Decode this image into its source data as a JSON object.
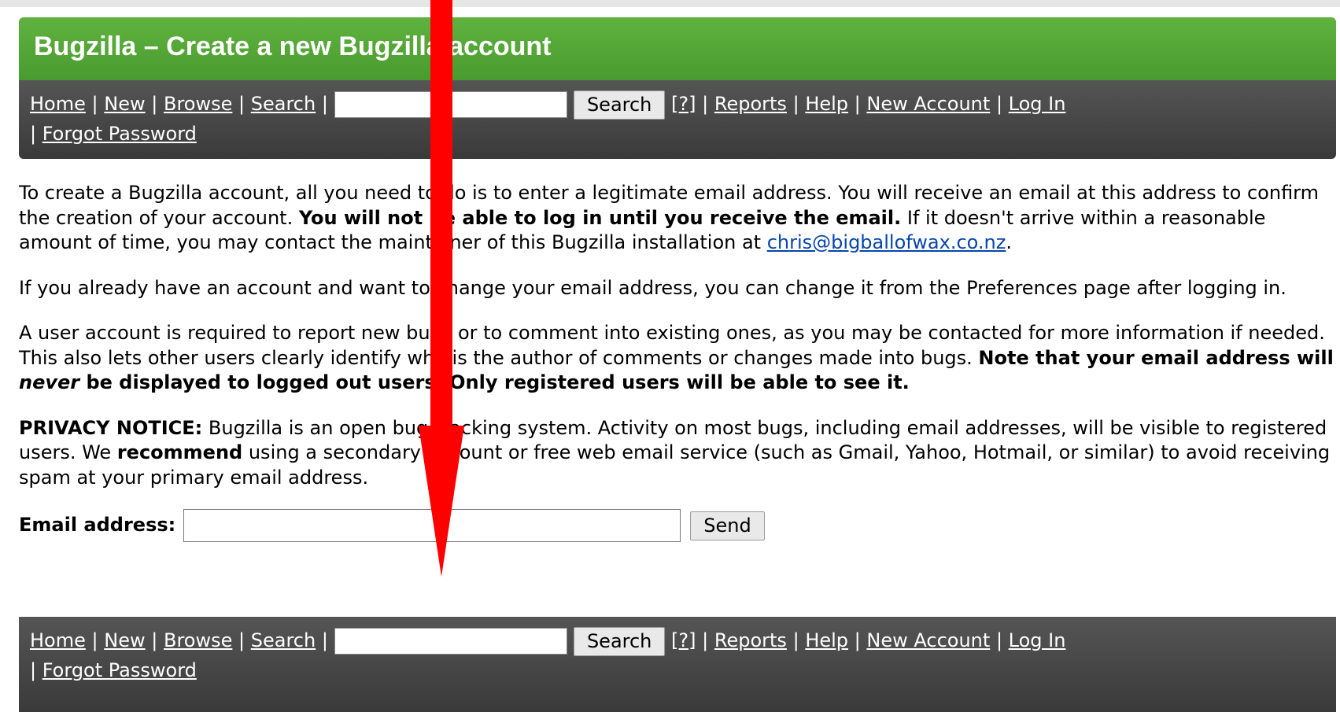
{
  "page_title": "Bugzilla – Create a new Bugzilla account",
  "nav": {
    "home": "Home",
    "new": "New",
    "browse": "Browse",
    "search": "Search",
    "search_button": "Search",
    "help_bracket": "[?]",
    "reports": "Reports",
    "help": "Help",
    "new_account": "New Account",
    "log_in": "Log In",
    "forgot_password": "Forgot Password",
    "separator": "|"
  },
  "intro": {
    "part1": "To create a Bugzilla account, all you need to do is to enter a legitimate email address. You will receive an email at this address to confirm the creation of your account. ",
    "bold": "You will not be able to log in until you receive the email.",
    "part2": " If it doesn't arrive within a reasonable amount of time, you may contact the maintainer of this Bugzilla installation at ",
    "email_link": "chris@bigballofwax.co.nz",
    "end": "."
  },
  "change_email_text": "If you already have an account and want to change your email address, you can change it from the Preferences page after logging in.",
  "account_required": {
    "text": "A user account is required to report new bugs or to comment into existing ones, as you may be contacted for more information if needed. This also lets other users clearly identify who is the author of comments or changes made into bugs. ",
    "bold_part1": "Note that your email address will ",
    "bold_italic": "never",
    "bold_part2": " be displayed to logged out users. Only registered users will be able to see it."
  },
  "privacy": {
    "label": "PRIVACY NOTICE:",
    "text1": " Bugzilla is an open bug tracking system. Activity on most bugs, including email addresses, will be visible to registered users. We ",
    "bold": "recommend",
    "text2": " using a secondary account or free web email service (such as Gmail, Yahoo, Hotmail, or similar) to avoid receiving spam at your primary email address."
  },
  "form": {
    "email_label": "Email address:",
    "send_button": "Send",
    "email_value": ""
  },
  "annotation": {
    "arrow_color": "#ff0000"
  }
}
